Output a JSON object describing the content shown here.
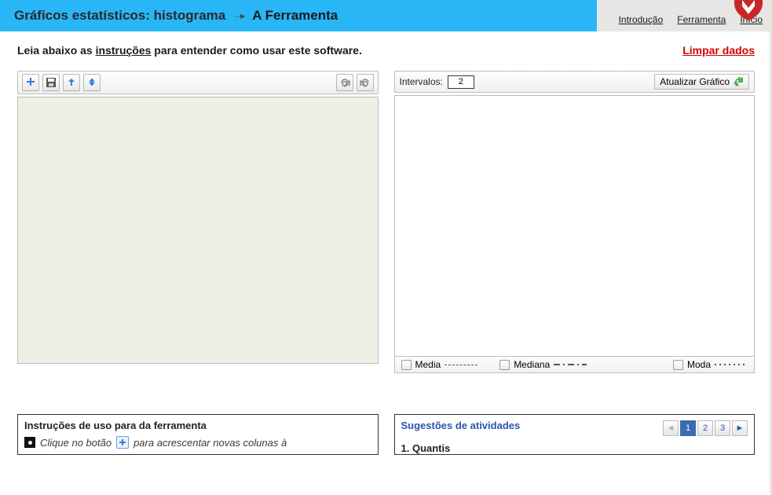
{
  "header": {
    "title_main": "Gráficos estatísticos: histograma",
    "title_sub": "A Ferramenta"
  },
  "nav": {
    "introducao": "Introdução",
    "ferramenta": "Ferramenta",
    "inicio": "Início"
  },
  "intro": {
    "prefix": "Leia abaixo as ",
    "link": "instruções",
    "suffix": " para entender como usar este software."
  },
  "clear_data": "Limpar dados",
  "left_toolbar": {
    "add": "add",
    "save": "save",
    "import": "import",
    "export": "export",
    "redo": "redo",
    "undo": "undo"
  },
  "chart_toolbar": {
    "intervalos_label": "Intervalos:",
    "intervalos_value": "2",
    "update_label": "Atualizar Gráfico"
  },
  "legend": {
    "media": "Media",
    "mediana": "Mediana",
    "moda": "Moda"
  },
  "instructions": {
    "title": "Instruções de uso para da ferramenta",
    "line1_prefix": "Clique no botão ",
    "line1_suffix": " para acrescentar novas colunas à"
  },
  "activities": {
    "title": "Sugestões de atividades",
    "pages": [
      "1",
      "2",
      "3"
    ],
    "current_page": 1,
    "item1": "1. Quantis"
  },
  "colors": {
    "header_bg": "#29b6f6",
    "danger": "#d40000",
    "blue": "#2658a6"
  }
}
